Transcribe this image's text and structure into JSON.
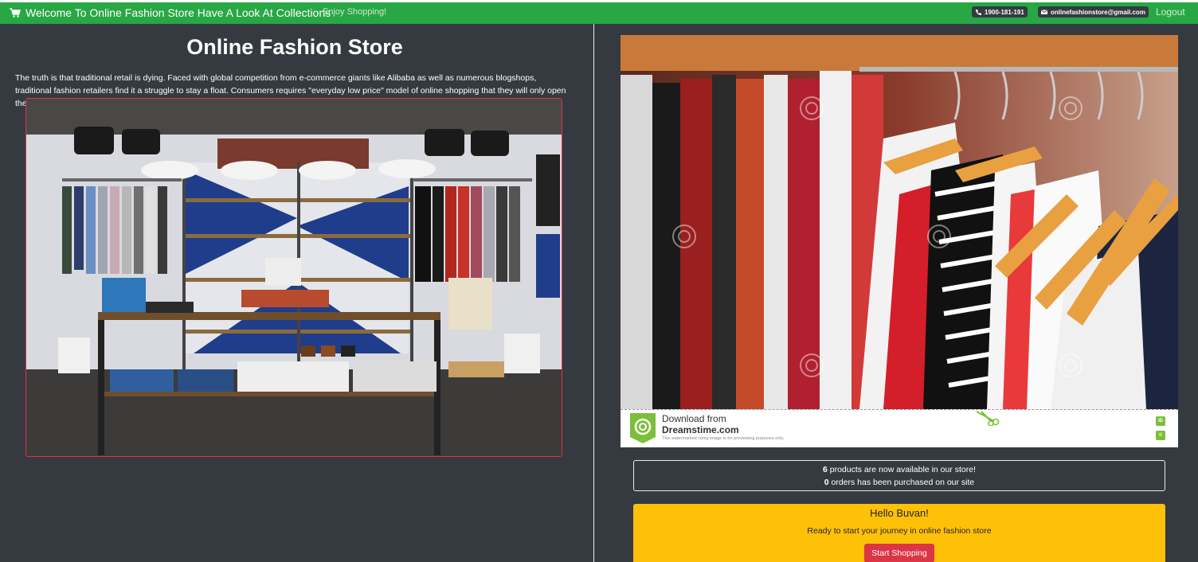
{
  "topbar": {
    "brand": "Welcome To Online Fashion Store Have A Look At Collections",
    "tagline": "Enjoy Shopping!",
    "phone": "1900-181-191",
    "email": "onlinefashionstore@gmail.com",
    "logout": "Logout"
  },
  "main": {
    "title": "Online Fashion Store",
    "intro": "The truth is that traditional retail is dying. Faced with global competition from e-commerce giants like Alibaba as well as numerous blogshops, traditional fashion retailers find it a struggle to stay a float. Consumers requires \"everyday low price\" model of online shopping that they will only open their wallets at a brick and mortar store when an irresistible deal presents itself."
  },
  "photo_credit": {
    "line1": "Download from",
    "line2": "Dreamstime.com",
    "line3": "This watermarked comp image is for previewing purposes only.",
    "badge_top": "ID",
    "badge_bottom": "©"
  },
  "stats": {
    "products_count": "6",
    "products_text": " products are now available in our store!",
    "orders_count": "0",
    "orders_text": " orders has been purchased on our site"
  },
  "greeting": {
    "title": "Hello Buvan!",
    "subtitle": "Ready to start your journey in online fashion store",
    "button": "Start Shopping"
  },
  "colors": {
    "topbar": "#28a745",
    "background": "#343a40",
    "greeting_bg": "#ffc107",
    "button": "#dc3545"
  }
}
